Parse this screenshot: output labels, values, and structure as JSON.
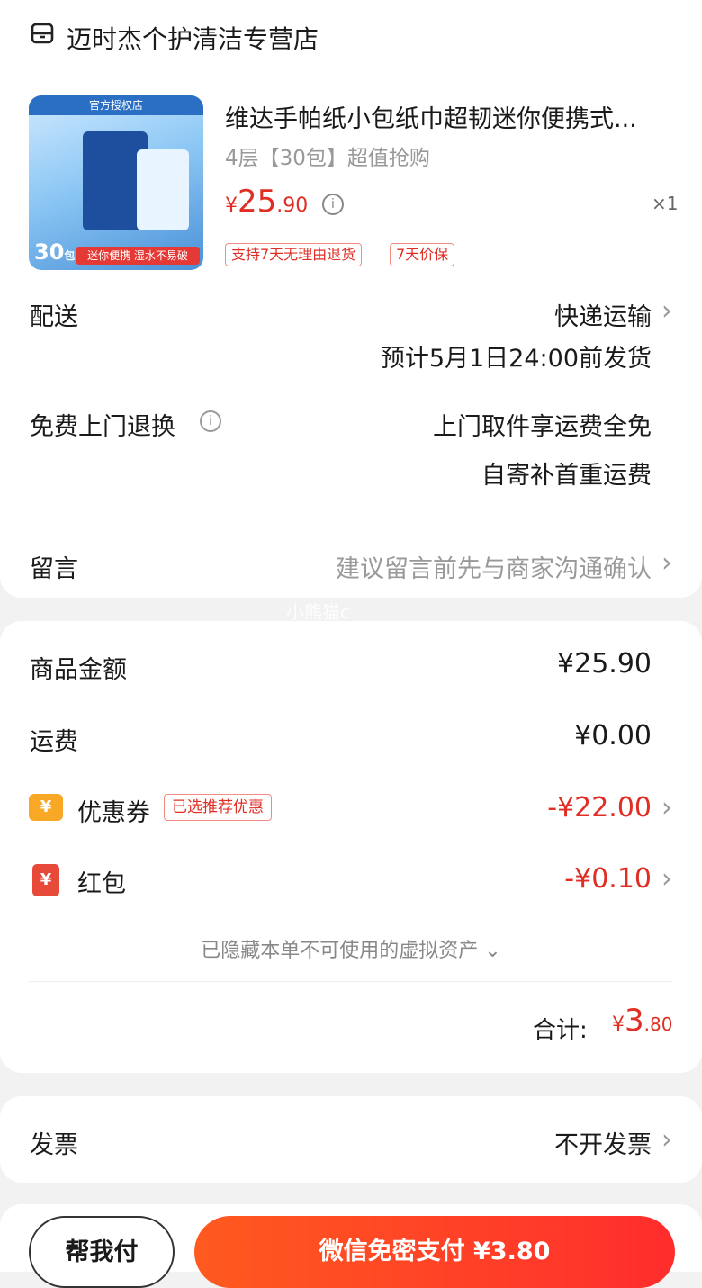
{
  "store": {
    "name": "迈时杰个护清洁专营店",
    "icon": "store-icon"
  },
  "product": {
    "title": "维达手帕纸小包纸巾超韧迷你便携式...",
    "spec": "4层【30包】超值抢购",
    "price_symbol": "¥",
    "price_int": "25",
    "price_dec": ".90",
    "quantity": "×1",
    "tags": [
      "支持7天无理由退货",
      "7天价保"
    ],
    "image": {
      "banner": "官方授权店",
      "count": "30",
      "count_unit": "包",
      "slogan": "迷你便携 湿水不易破"
    }
  },
  "delivery": {
    "label": "配送",
    "method": "快递运输",
    "estimate": "预计5月1日24:00前发货"
  },
  "returns": {
    "label": "免费上门退换",
    "line1": "上门取件享运费全免",
    "line2": "自寄补首重运费"
  },
  "message": {
    "label": "留言",
    "hint": "建议留言前先与商家沟通确认"
  },
  "watermark": "小熊猫c",
  "summary": {
    "goods_label": "商品金额",
    "goods_value": "¥25.90",
    "shipping_label": "运费",
    "shipping_value": "¥0.00",
    "coupon_label": "优惠券",
    "coupon_tag": "已选推荐优惠",
    "coupon_value": "-¥22.00",
    "redpacket_label": "红包",
    "redpacket_value": "-¥0.10",
    "hidden_assets": "已隐藏本单不可使用的虚拟资产 ⌄",
    "total_label": "合计:",
    "total_symbol": "¥",
    "total_int": "3",
    "total_dec": ".80"
  },
  "invoice": {
    "label": "发票",
    "value": "不开发票"
  },
  "actions": {
    "help_pay": "帮我付",
    "pay": "微信免密支付 ¥3.80"
  },
  "colors": {
    "accent_red": "#e02e24",
    "coupon_yellow": "#f9a825",
    "pay_gradient_start": "#ff5a1f",
    "pay_gradient_end": "#ff2d2d"
  }
}
